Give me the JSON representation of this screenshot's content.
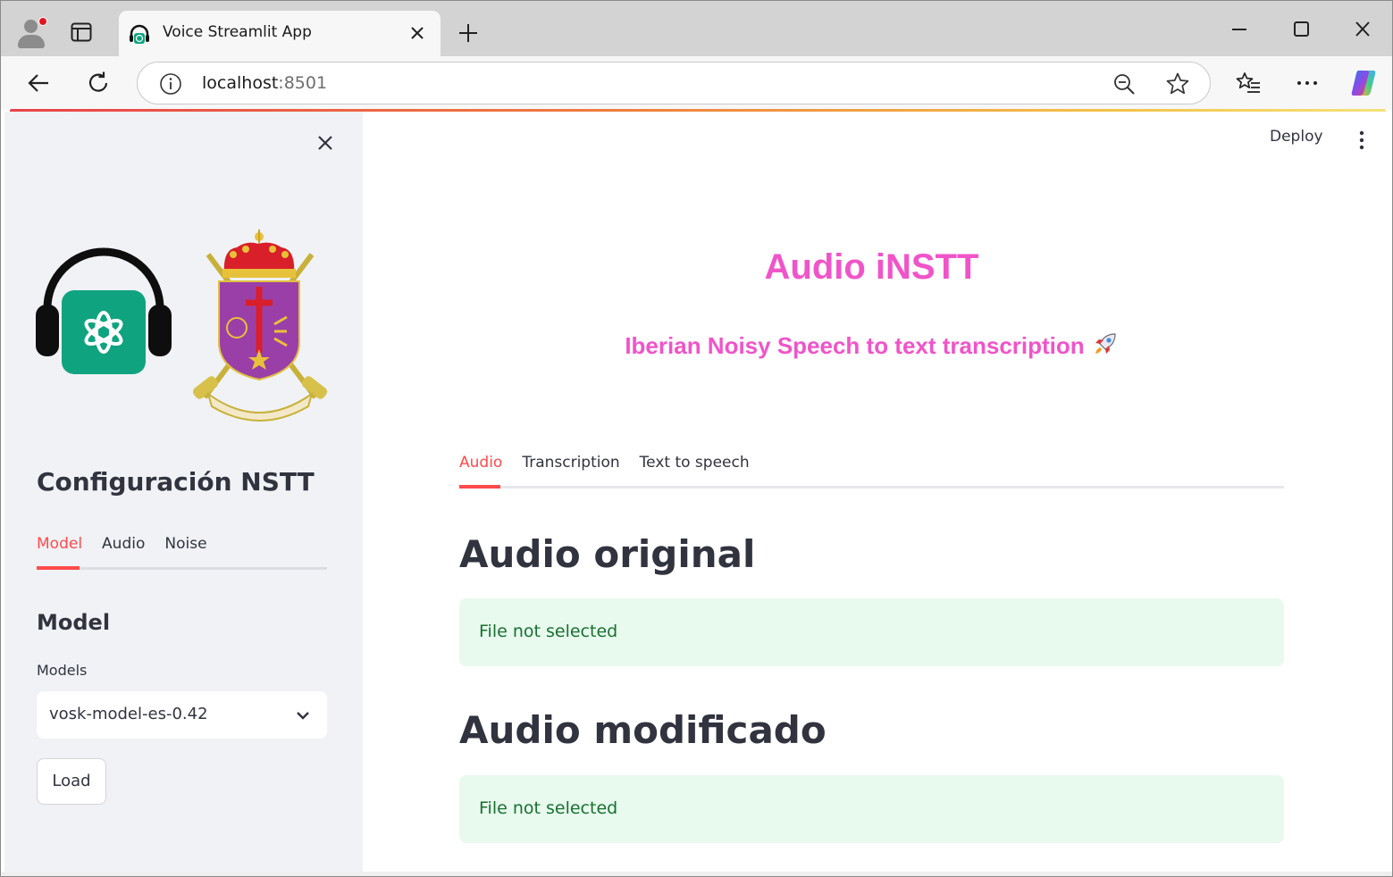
{
  "browser": {
    "tab_title": "Voice Streamlit App",
    "url_host": "localhost",
    "url_port": ":8501"
  },
  "header": {
    "deploy_label": "Deploy"
  },
  "sidebar": {
    "title": "Configuración NSTT",
    "tabs": [
      {
        "label": "Model",
        "active": true
      },
      {
        "label": "Audio",
        "active": false
      },
      {
        "label": "Noise",
        "active": false
      }
    ],
    "section_heading": "Model",
    "models_label": "Models",
    "models_selected": "vosk-model-es-0.42",
    "load_button": "Load"
  },
  "main": {
    "title": "Audio iNSTT",
    "subtitle": "Iberian Noisy Speech to text transcription",
    "tabs": [
      {
        "label": "Audio",
        "active": true
      },
      {
        "label": "Transcription",
        "active": false
      },
      {
        "label": "Text to speech",
        "active": false
      }
    ],
    "sections": [
      {
        "heading": "Audio original",
        "status": "File not selected"
      },
      {
        "heading": "Audio modificado",
        "status": "File not selected"
      }
    ]
  },
  "colors": {
    "accent": "#ff4b4b",
    "title_pink": "#f054c9",
    "success_bg": "#e8f9ee",
    "success_text": "#17712f",
    "sidebar_bg": "#f0f2f6"
  },
  "icons": [
    "profile-icon",
    "tab-actions-icon",
    "headphones-favicon",
    "close-icon",
    "new-tab-icon",
    "minimize-icon",
    "maximize-icon",
    "window-close-icon",
    "back-icon",
    "refresh-icon",
    "info-icon",
    "zoom-out-icon",
    "star-icon",
    "favorites-icon",
    "more-icon",
    "copilot-icon",
    "chevron-down-icon",
    "kebab-menu-icon",
    "rocket-icon"
  ]
}
